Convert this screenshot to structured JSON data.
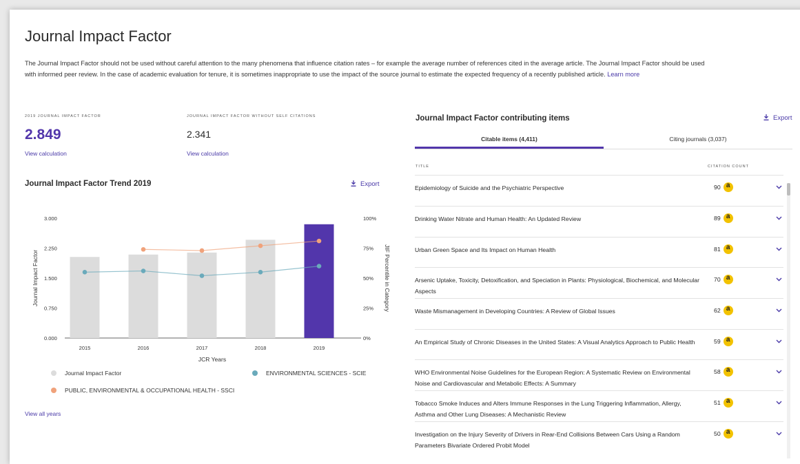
{
  "page": {
    "title": "Journal Impact Factor",
    "description": "The Journal Impact Factor should not be used without careful attention to the many phenomena that influence citation rates – for example the average number of references cited in the average article. The Journal Impact Factor should be used with informed peer review. In the case of academic evaluation for tenure, it is sometimes inappropriate to use the impact of the source journal to estimate the expected frequency of a recently published article.",
    "learn_more": "Learn more"
  },
  "metrics": {
    "jif_caption": "2019 JOURNAL IMPACT FACTOR",
    "jif_value": "2.849",
    "jif_link": "View calculation",
    "self_caption": "JOURNAL IMPACT FACTOR WITHOUT SELF CITATIONS",
    "self_value": "2.341",
    "self_link": "View calculation"
  },
  "trend": {
    "title": "Journal Impact Factor Trend 2019",
    "export_label": "Export",
    "view_all": "View all years"
  },
  "chart_data": {
    "type": "bar",
    "categories": [
      "2015",
      "2016",
      "2017",
      "2018",
      "2019"
    ],
    "series": [
      {
        "name": "Journal Impact Factor",
        "kind": "bar",
        "axis": "left",
        "values": [
          2.03,
          2.09,
          2.14,
          2.46,
          2.849
        ]
      },
      {
        "name": "ENVIRONMENTAL SCIENCES - SCIE",
        "kind": "line",
        "axis": "right",
        "values": [
          55,
          56,
          52,
          55,
          60
        ]
      },
      {
        "name": "PUBLIC, ENVIRONMENTAL & OCCUPATIONAL HEALTH - SSCI",
        "kind": "line",
        "axis": "right",
        "values": [
          null,
          74,
          73,
          77,
          81
        ]
      }
    ],
    "xlabel": "JCR Years",
    "ylabel": "Journal Impact Factor",
    "y2label": "JIF Percentile in Category",
    "ylim": [
      0,
      3
    ],
    "y2lim": [
      0,
      100
    ],
    "yticks": [
      "0.000",
      "0.750",
      "1.500",
      "2.250",
      "3.000"
    ],
    "y2ticks": [
      "0%",
      "25%",
      "50%",
      "75%",
      "100%"
    ],
    "grid": false,
    "legend_position": "bottom",
    "colors": {
      "bar": "#dcdcdc",
      "bar_highlight": "#5236ab",
      "scie": "#6aaabb",
      "ssci": "#f0a27b"
    }
  },
  "contrib": {
    "title": "Journal Impact Factor contributing items",
    "export_label": "Export",
    "tabs": [
      {
        "label": "Citable items (4,411)",
        "active": true
      },
      {
        "label": "Citing journals (3,037)",
        "active": false
      }
    ],
    "col_title": "TITLE",
    "col_count": "CITATION COUNT",
    "rows": [
      {
        "title": "Epidemiology of Suicide and the Psychiatric Perspective",
        "count": "90"
      },
      {
        "title": "Drinking Water Nitrate and Human Health: An Updated Review",
        "count": "89"
      },
      {
        "title": "Urban Green Space and Its Impact on Human Health",
        "count": "81"
      },
      {
        "title": "Arsenic Uptake, Toxicity, Detoxification, and Speciation in Plants: Physiological, Biochemical, and Molecular Aspects",
        "count": "70"
      },
      {
        "title": "Waste Mismanagement in Developing Countries: A Review of Global Issues",
        "count": "62"
      },
      {
        "title": "An Empirical Study of Chronic Diseases in the United States: A Visual Analytics Approach to Public Health",
        "count": "59"
      },
      {
        "title": "WHO Environmental Noise Guidelines for the European Region: A Systematic Review on Environmental Noise and Cardiovascular and Metabolic Effects: A Summary",
        "count": "58"
      },
      {
        "title": "Tobacco Smoke Induces and Alters Immune Responses in the Lung Triggering Inflammation, Allergy, Asthma and Other Lung Diseases: A Mechanistic Review",
        "count": "51"
      },
      {
        "title": "Investigation on the Injury Severity of Drivers in Rear-End Collisions Between Cars Using a Random Parameters Bivariate Ordered Probit Model",
        "count": "50"
      }
    ]
  }
}
